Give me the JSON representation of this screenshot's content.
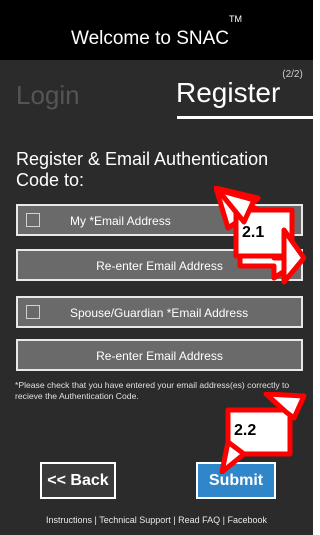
{
  "header": {
    "title": "Welcome to SNAC",
    "trademark": "TM"
  },
  "tabs": {
    "login": "Login",
    "register": "Register",
    "step": "(2/2)"
  },
  "form": {
    "heading": "Register & Email Authentication Code to:",
    "email_label": "My *Email Address",
    "email_confirm_label": "Re-enter Email Address",
    "guardian_email_label": "Spouse/Guardian *Email Address",
    "guardian_email_confirm_label": "Re-enter Email Address",
    "note": "*Please check that you have entered your email address(es) correctly to recieve the Authentication Code."
  },
  "buttons": {
    "back": "<< Back",
    "submit": "Submit"
  },
  "footer": {
    "text": "Instructions | Technical Support | Read FAQ | Facebook"
  },
  "annotations": {
    "callout_1": "2.1",
    "callout_2": "2.2",
    "callout_color": "#ff0000"
  },
  "colors": {
    "submit": "#2f86c8",
    "header_bg": "#000000",
    "panel_bg": "#2b2b2b"
  }
}
